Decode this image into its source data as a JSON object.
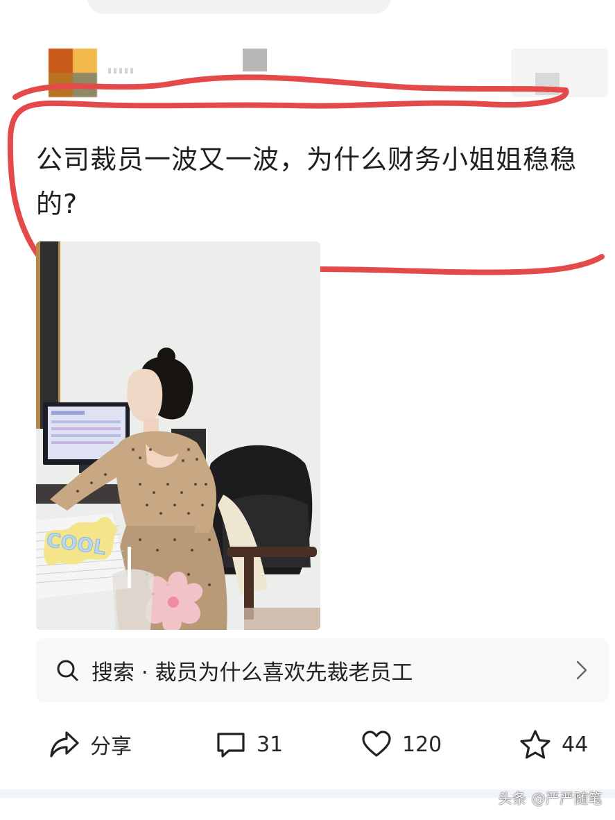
{
  "post": {
    "headline": "公司裁员一波又一波，为什么财务小姐姐稳稳的?",
    "image_sticker_text": "COOL"
  },
  "search": {
    "label": "搜索 · 裁员为什么喜欢先裁老员工"
  },
  "actions": {
    "share_label": "分享",
    "comment_count": "31",
    "like_count": "120",
    "favorite_count": "44"
  },
  "watermark": {
    "text": "头条 @严严随笔"
  },
  "colors": {
    "annotation": "#e54a4a",
    "search_background": "#f7f8fa"
  },
  "icons": {
    "search": "search-icon",
    "chevron": "chevron-right-icon",
    "share": "share-icon",
    "comment": "comment-icon",
    "like": "heart-icon",
    "favorite": "star-icon"
  }
}
